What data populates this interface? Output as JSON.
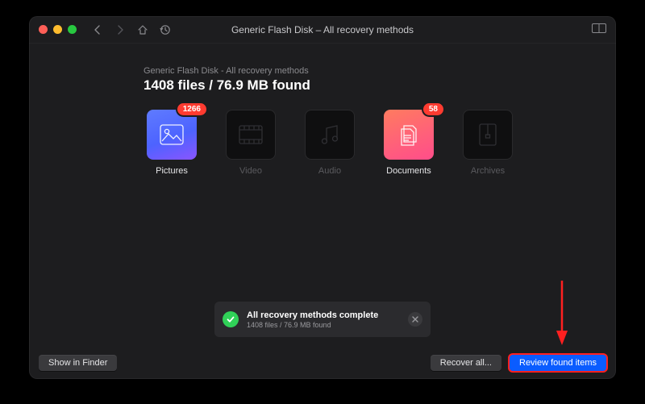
{
  "window": {
    "title": "Generic Flash Disk – All recovery methods"
  },
  "header": {
    "subhead": "Generic Flash Disk - All recovery methods",
    "headline": "1408 files / 76.9 MB found"
  },
  "categories": [
    {
      "key": "pictures",
      "label": "Pictures",
      "count": 1266,
      "style": "pictures",
      "active": true
    },
    {
      "key": "video",
      "label": "Video",
      "count": null,
      "style": "outline",
      "active": false
    },
    {
      "key": "audio",
      "label": "Audio",
      "count": null,
      "style": "outline",
      "active": false
    },
    {
      "key": "documents",
      "label": "Documents",
      "count": 58,
      "style": "documents",
      "active": true
    },
    {
      "key": "archives",
      "label": "Archives",
      "count": null,
      "style": "outline",
      "active": false
    }
  ],
  "toast": {
    "title": "All recovery methods complete",
    "subtitle": "1408 files / 76.9 MB found"
  },
  "footer": {
    "show_in_finder": "Show in Finder",
    "recover_all": "Recover all...",
    "review": "Review found items"
  },
  "colors": {
    "accent_blue": "#0a5cff",
    "badge_red": "#ff3b30",
    "success_green": "#30d158",
    "annotation_red": "#ff2020"
  }
}
